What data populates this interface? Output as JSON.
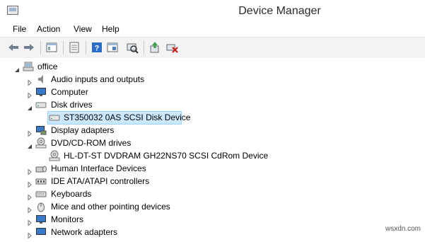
{
  "window": {
    "title": "Device Manager"
  },
  "menu": {
    "items": [
      "File",
      "Action",
      "View",
      "Help"
    ]
  },
  "toolbar": {
    "buttons": [
      "back-arrow",
      "forward-arrow",
      "up-folder",
      "properties",
      "help",
      "view-console",
      "scan-hardware",
      "update-driver",
      "uninstall-device"
    ]
  },
  "tree": {
    "root": "office",
    "items": [
      {
        "label": "Audio inputs and outputs",
        "expanded": false
      },
      {
        "label": "Computer",
        "expanded": false
      },
      {
        "label": "Disk drives",
        "expanded": true
      },
      {
        "label": "ST350032 0AS SCSI Disk Device",
        "child": true,
        "selected": true
      },
      {
        "label": "Display adapters",
        "expanded": false
      },
      {
        "label": "DVD/CD-ROM drives",
        "expanded": true
      },
      {
        "label": "HL-DT-ST DVDRAM GH22NS70 SCSI CdRom Device",
        "child": true
      },
      {
        "label": "Human Interface Devices",
        "expanded": false
      },
      {
        "label": "IDE ATA/ATAPI controllers",
        "expanded": false
      },
      {
        "label": "Keyboards",
        "expanded": false
      },
      {
        "label": "Mice and other pointing devices",
        "expanded": false
      },
      {
        "label": "Monitors",
        "expanded": false
      },
      {
        "label": "Network adapters",
        "expanded": false
      }
    ]
  },
  "watermark": "wsxdn.com",
  "colors": {
    "selection": "#cce8ff",
    "selection_border": "#99d1ff",
    "toolbar_bg": "#f3f3f3"
  }
}
